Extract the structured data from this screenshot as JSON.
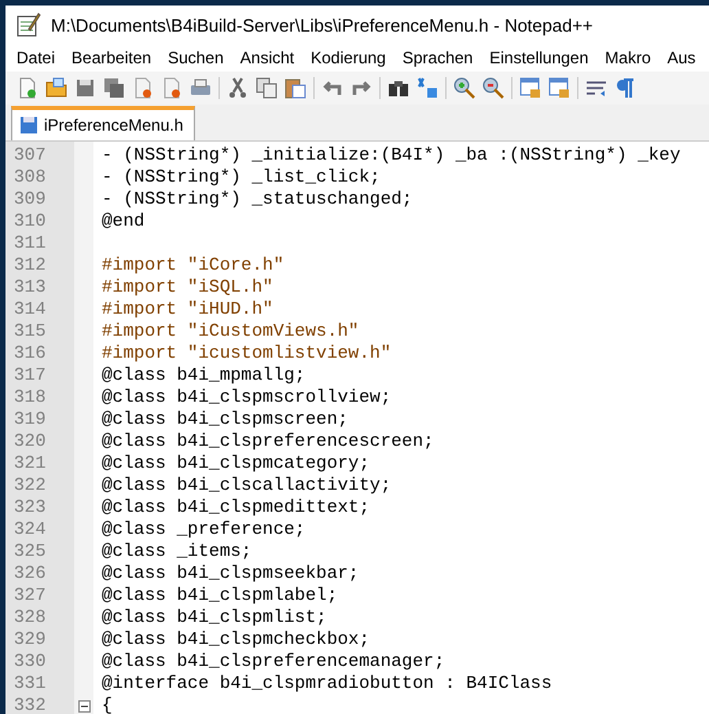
{
  "window": {
    "title": "M:\\Documents\\B4iBuild-Server\\Libs\\iPreferenceMenu.h - Notepad++"
  },
  "menu": [
    "Datei",
    "Bearbeiten",
    "Suchen",
    "Ansicht",
    "Kodierung",
    "Sprachen",
    "Einstellungen",
    "Makro",
    "Aus"
  ],
  "tabs": [
    {
      "label": "iPreferenceMenu.h",
      "selected": true
    }
  ],
  "lines": [
    {
      "number": "307",
      "kind": "code",
      "text": "- (NSString*)  _initialize:(B4I*) _ba :(NSString*) _key"
    },
    {
      "number": "308",
      "kind": "code",
      "text": "- (NSString*)  _list_click;"
    },
    {
      "number": "309",
      "kind": "code",
      "text": "- (NSString*)  _statuschanged;"
    },
    {
      "number": "310",
      "kind": "code",
      "text": "@end"
    },
    {
      "number": "311",
      "kind": "blank"
    },
    {
      "number": "312",
      "kind": "preprocessor",
      "text": "#import \"iCore.h\""
    },
    {
      "number": "313",
      "kind": "preprocessor",
      "text": "#import \"iSQL.h\""
    },
    {
      "number": "314",
      "kind": "preprocessor",
      "text": "#import \"iHUD.h\""
    },
    {
      "number": "315",
      "kind": "preprocessor",
      "text": "#import \"iCustomViews.h\""
    },
    {
      "number": "316",
      "kind": "preprocessor",
      "text": "#import \"icustomlistview.h\""
    },
    {
      "number": "317",
      "kind": "code",
      "text": "@class b4i_mpmallg;"
    },
    {
      "number": "318",
      "kind": "code",
      "text": "@class b4i_clspmscrollview;"
    },
    {
      "number": "319",
      "kind": "code",
      "text": "@class b4i_clspmscreen;"
    },
    {
      "number": "320",
      "kind": "code",
      "text": "@class b4i_clspreferencescreen;"
    },
    {
      "number": "321",
      "kind": "code",
      "text": "@class b4i_clspmcategory;"
    },
    {
      "number": "322",
      "kind": "code",
      "text": "@class b4i_clscallactivity;"
    },
    {
      "number": "323",
      "kind": "code",
      "text": "@class b4i_clspmedittext;"
    },
    {
      "number": "324",
      "kind": "code",
      "text": "@class _preference;"
    },
    {
      "number": "325",
      "kind": "code",
      "text": "@class _items;"
    },
    {
      "number": "326",
      "kind": "code",
      "text": "@class b4i_clspmseekbar;"
    },
    {
      "number": "327",
      "kind": "code",
      "text": "@class b4i_clspmlabel;"
    },
    {
      "number": "328",
      "kind": "code",
      "text": "@class b4i_clspmlist;"
    },
    {
      "number": "329",
      "kind": "code",
      "text": "@class b4i_clspmcheckbox;"
    },
    {
      "number": "330",
      "kind": "code",
      "text": "@class b4i_clspreferencemanager;"
    },
    {
      "number": "331",
      "kind": "code",
      "text": "@interface b4i_clspmradiobutton : B4IClass"
    },
    {
      "number": "332",
      "kind": "fold",
      "text": "{"
    }
  ]
}
